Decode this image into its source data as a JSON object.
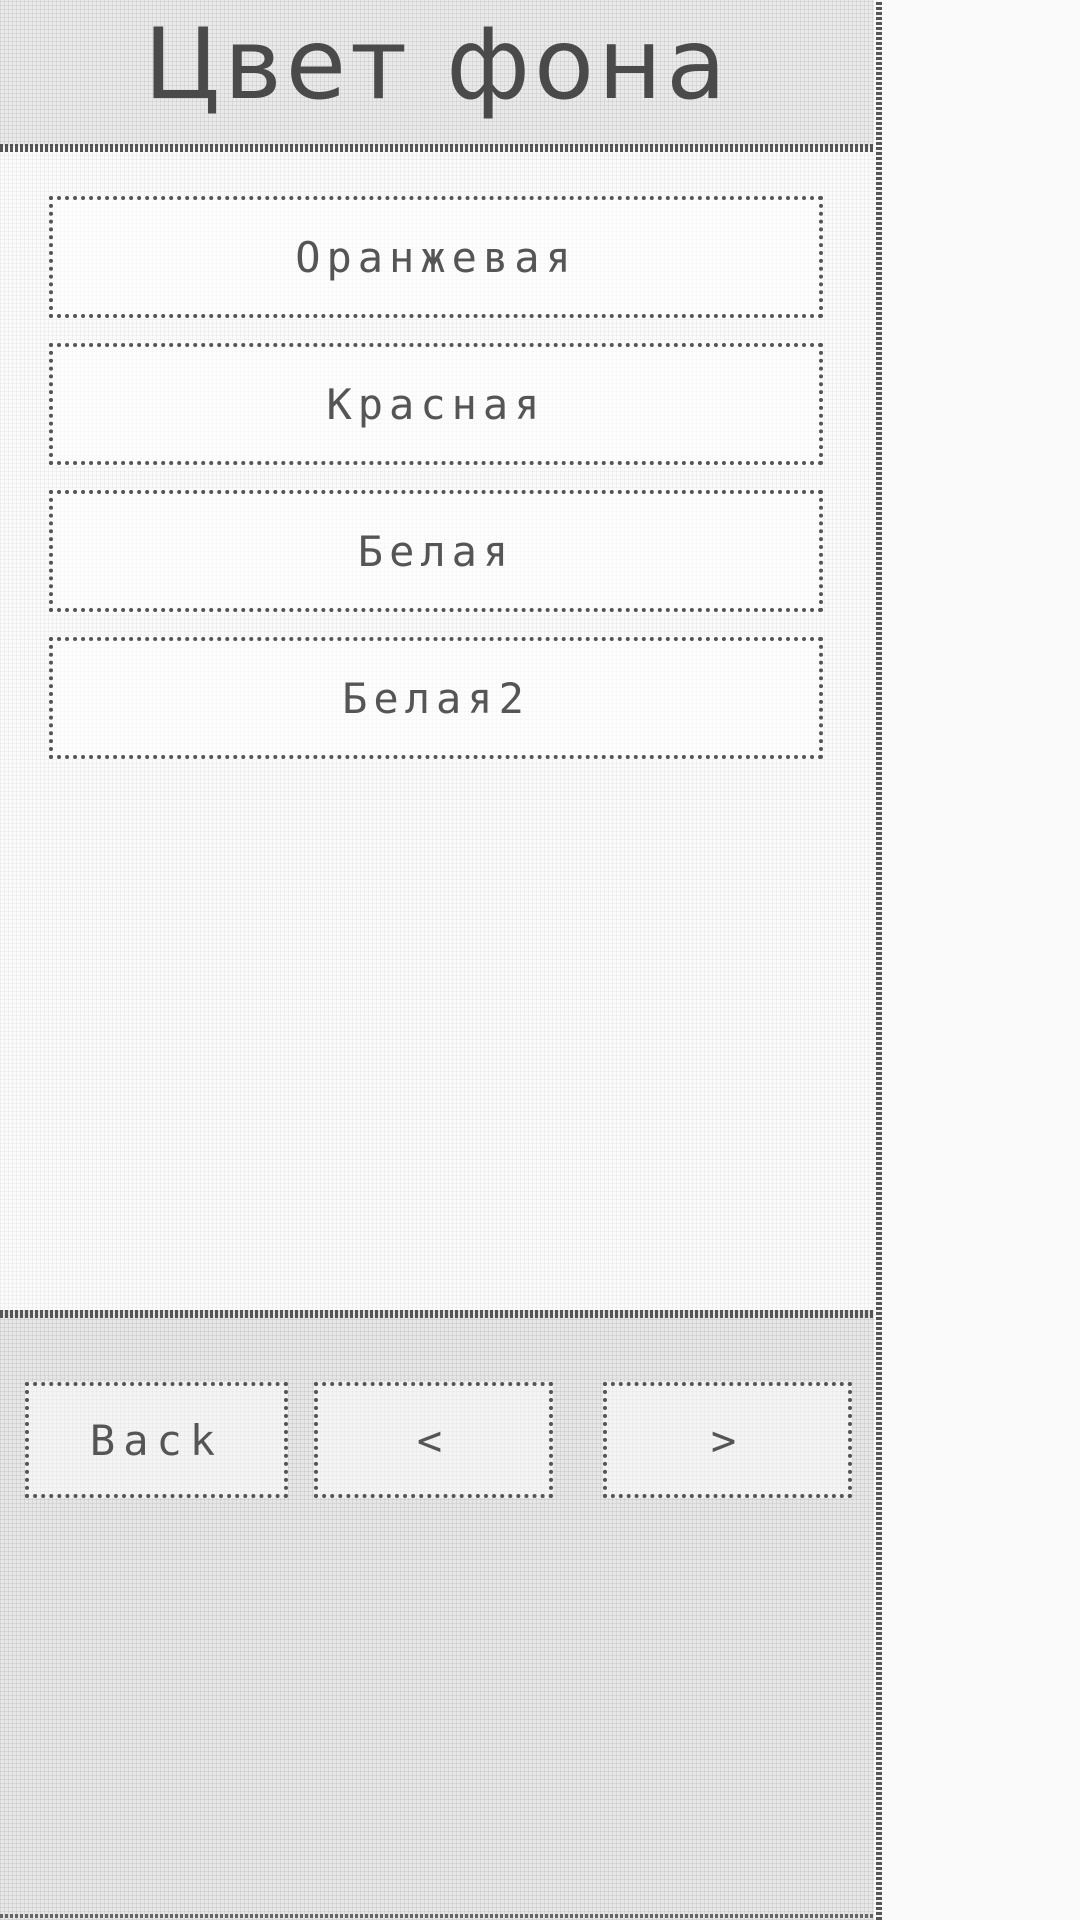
{
  "header": {
    "title": "Цвет фона"
  },
  "options": [
    {
      "label": "Оранжевая"
    },
    {
      "label": "Красная"
    },
    {
      "label": "Белая"
    },
    {
      "label": "Белая2"
    }
  ],
  "footer": {
    "back_label": "Back",
    "prev_label": "<",
    "next_label": ">"
  },
  "colors": {
    "text": "#555555",
    "background": "#fbfbfb",
    "header_bg": "#e9e9e9"
  }
}
